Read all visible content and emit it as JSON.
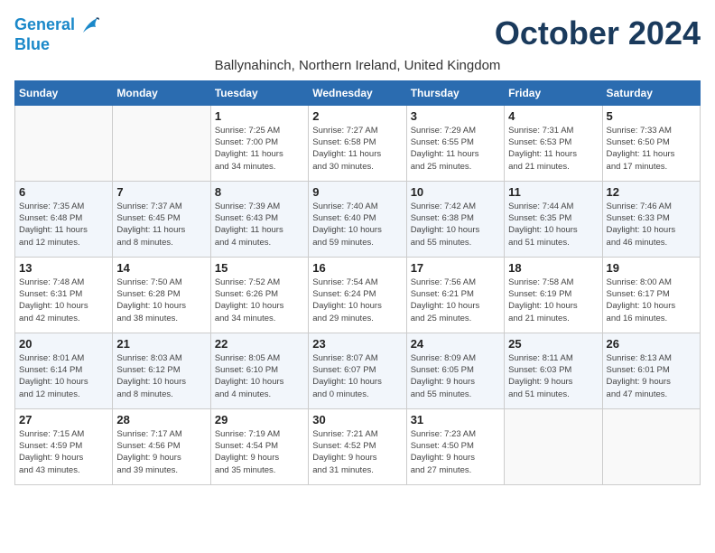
{
  "header": {
    "logo_line1": "General",
    "logo_line2": "Blue",
    "month_title": "October 2024",
    "location": "Ballynahinch, Northern Ireland, United Kingdom"
  },
  "days_of_week": [
    "Sunday",
    "Monday",
    "Tuesday",
    "Wednesday",
    "Thursday",
    "Friday",
    "Saturday"
  ],
  "weeks": [
    [
      {
        "day": "",
        "info": ""
      },
      {
        "day": "",
        "info": ""
      },
      {
        "day": "1",
        "info": "Sunrise: 7:25 AM\nSunset: 7:00 PM\nDaylight: 11 hours\nand 34 minutes."
      },
      {
        "day": "2",
        "info": "Sunrise: 7:27 AM\nSunset: 6:58 PM\nDaylight: 11 hours\nand 30 minutes."
      },
      {
        "day": "3",
        "info": "Sunrise: 7:29 AM\nSunset: 6:55 PM\nDaylight: 11 hours\nand 25 minutes."
      },
      {
        "day": "4",
        "info": "Sunrise: 7:31 AM\nSunset: 6:53 PM\nDaylight: 11 hours\nand 21 minutes."
      },
      {
        "day": "5",
        "info": "Sunrise: 7:33 AM\nSunset: 6:50 PM\nDaylight: 11 hours\nand 17 minutes."
      }
    ],
    [
      {
        "day": "6",
        "info": "Sunrise: 7:35 AM\nSunset: 6:48 PM\nDaylight: 11 hours\nand 12 minutes."
      },
      {
        "day": "7",
        "info": "Sunrise: 7:37 AM\nSunset: 6:45 PM\nDaylight: 11 hours\nand 8 minutes."
      },
      {
        "day": "8",
        "info": "Sunrise: 7:39 AM\nSunset: 6:43 PM\nDaylight: 11 hours\nand 4 minutes."
      },
      {
        "day": "9",
        "info": "Sunrise: 7:40 AM\nSunset: 6:40 PM\nDaylight: 10 hours\nand 59 minutes."
      },
      {
        "day": "10",
        "info": "Sunrise: 7:42 AM\nSunset: 6:38 PM\nDaylight: 10 hours\nand 55 minutes."
      },
      {
        "day": "11",
        "info": "Sunrise: 7:44 AM\nSunset: 6:35 PM\nDaylight: 10 hours\nand 51 minutes."
      },
      {
        "day": "12",
        "info": "Sunrise: 7:46 AM\nSunset: 6:33 PM\nDaylight: 10 hours\nand 46 minutes."
      }
    ],
    [
      {
        "day": "13",
        "info": "Sunrise: 7:48 AM\nSunset: 6:31 PM\nDaylight: 10 hours\nand 42 minutes."
      },
      {
        "day": "14",
        "info": "Sunrise: 7:50 AM\nSunset: 6:28 PM\nDaylight: 10 hours\nand 38 minutes."
      },
      {
        "day": "15",
        "info": "Sunrise: 7:52 AM\nSunset: 6:26 PM\nDaylight: 10 hours\nand 34 minutes."
      },
      {
        "day": "16",
        "info": "Sunrise: 7:54 AM\nSunset: 6:24 PM\nDaylight: 10 hours\nand 29 minutes."
      },
      {
        "day": "17",
        "info": "Sunrise: 7:56 AM\nSunset: 6:21 PM\nDaylight: 10 hours\nand 25 minutes."
      },
      {
        "day": "18",
        "info": "Sunrise: 7:58 AM\nSunset: 6:19 PM\nDaylight: 10 hours\nand 21 minutes."
      },
      {
        "day": "19",
        "info": "Sunrise: 8:00 AM\nSunset: 6:17 PM\nDaylight: 10 hours\nand 16 minutes."
      }
    ],
    [
      {
        "day": "20",
        "info": "Sunrise: 8:01 AM\nSunset: 6:14 PM\nDaylight: 10 hours\nand 12 minutes."
      },
      {
        "day": "21",
        "info": "Sunrise: 8:03 AM\nSunset: 6:12 PM\nDaylight: 10 hours\nand 8 minutes."
      },
      {
        "day": "22",
        "info": "Sunrise: 8:05 AM\nSunset: 6:10 PM\nDaylight: 10 hours\nand 4 minutes."
      },
      {
        "day": "23",
        "info": "Sunrise: 8:07 AM\nSunset: 6:07 PM\nDaylight: 10 hours\nand 0 minutes."
      },
      {
        "day": "24",
        "info": "Sunrise: 8:09 AM\nSunset: 6:05 PM\nDaylight: 9 hours\nand 55 minutes."
      },
      {
        "day": "25",
        "info": "Sunrise: 8:11 AM\nSunset: 6:03 PM\nDaylight: 9 hours\nand 51 minutes."
      },
      {
        "day": "26",
        "info": "Sunrise: 8:13 AM\nSunset: 6:01 PM\nDaylight: 9 hours\nand 47 minutes."
      }
    ],
    [
      {
        "day": "27",
        "info": "Sunrise: 7:15 AM\nSunset: 4:59 PM\nDaylight: 9 hours\nand 43 minutes."
      },
      {
        "day": "28",
        "info": "Sunrise: 7:17 AM\nSunset: 4:56 PM\nDaylight: 9 hours\nand 39 minutes."
      },
      {
        "day": "29",
        "info": "Sunrise: 7:19 AM\nSunset: 4:54 PM\nDaylight: 9 hours\nand 35 minutes."
      },
      {
        "day": "30",
        "info": "Sunrise: 7:21 AM\nSunset: 4:52 PM\nDaylight: 9 hours\nand 31 minutes."
      },
      {
        "day": "31",
        "info": "Sunrise: 7:23 AM\nSunset: 4:50 PM\nDaylight: 9 hours\nand 27 minutes."
      },
      {
        "day": "",
        "info": ""
      },
      {
        "day": "",
        "info": ""
      }
    ]
  ]
}
